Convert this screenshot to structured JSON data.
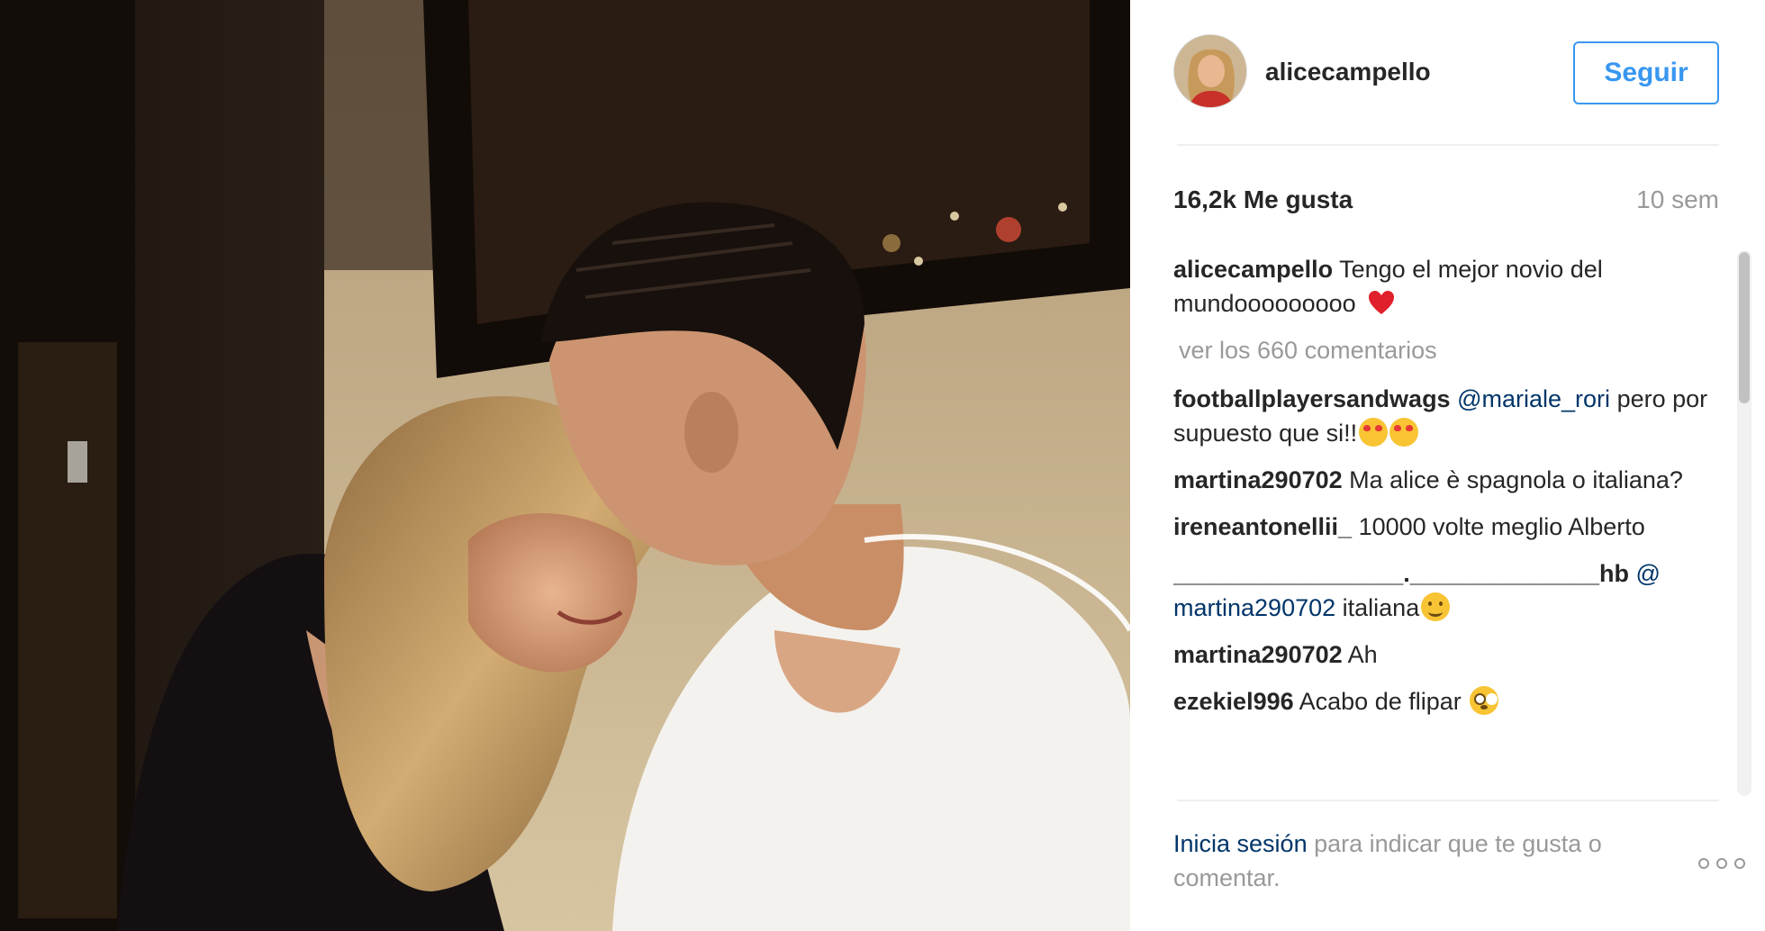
{
  "post": {
    "username": "alicecampello",
    "follow_label": "Seguir",
    "likes": "16,2k Me gusta",
    "time_ago": "10 sem"
  },
  "caption": {
    "user": "alicecampello",
    "text": "Tengo el mejor novio del mundooooooooo",
    "icon": "red-heart-icon"
  },
  "view_comments": "ver los 660 comentarios",
  "comments": [
    {
      "user": "footballplayersandwags",
      "mention": "@mariale_rori",
      "text": "pero por supuesto que si!!",
      "emojis": [
        "heart-eyes",
        "heart-eyes"
      ]
    },
    {
      "user": "martina290702",
      "text": "Ma alice è spagnola o italiana?"
    },
    {
      "user": "ireneantonellii_",
      "text": "10000 volte meglio Alberto"
    },
    {
      "user": "_________________.______________hb",
      "mention": "@ martina290702",
      "text": "italiana",
      "emojis": [
        "smile"
      ]
    },
    {
      "user": "martina290702",
      "text": "Ah"
    },
    {
      "user": "ezekiel996",
      "text": "Acabo de flipar",
      "emojis": [
        "flushed"
      ]
    }
  ],
  "footer": {
    "login_link": "Inicia sesión",
    "login_rest": "para indicar que te gusta o comentar.",
    "more_icon": "more-options-icon"
  },
  "colors": {
    "accent": "#3897f0",
    "link": "#003569",
    "muted": "#999999"
  }
}
